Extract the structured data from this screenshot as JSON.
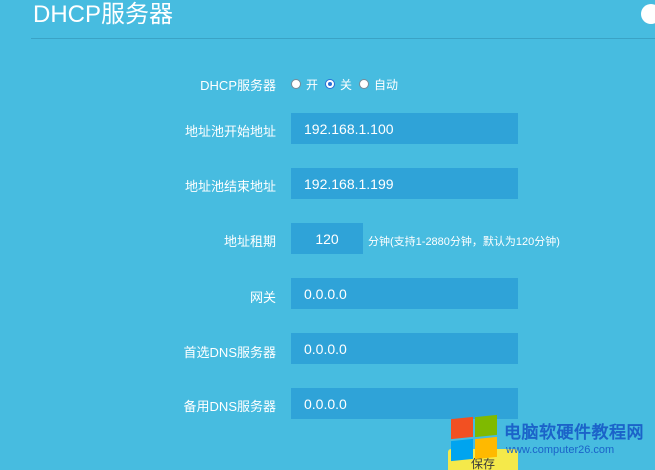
{
  "header": {
    "title": "DHCP服务器"
  },
  "dhcp": {
    "label": "DHCP服务器",
    "options": [
      {
        "label": "开",
        "selected": false
      },
      {
        "label": "关",
        "selected": true
      },
      {
        "label": "自动",
        "selected": false
      }
    ]
  },
  "fields": {
    "pool_start": {
      "label": "地址池开始地址",
      "value": "192.168.1.100"
    },
    "pool_end": {
      "label": "地址池结束地址",
      "value": "192.168.1.199"
    },
    "lease": {
      "label": "地址租期",
      "value": "120",
      "hint": "分钟(支持1-2880分钟，默认为120分钟)"
    },
    "gateway": {
      "label": "网关",
      "value": "0.0.0.0"
    },
    "primary_dns": {
      "label": "首选DNS服务器",
      "value": "0.0.0.0"
    },
    "backup_dns": {
      "label": "备用DNS服务器",
      "value": "0.0.0.0"
    }
  },
  "actions": {
    "save_label": "保存"
  },
  "watermark": {
    "title": "电脑软硬件教程网",
    "url": "www.computer26.com"
  },
  "colors": {
    "background": "#47bce0",
    "input_bg": "#2fa3d8",
    "save_button": "#f5e94a",
    "watermark_text": "#1b63c9"
  }
}
